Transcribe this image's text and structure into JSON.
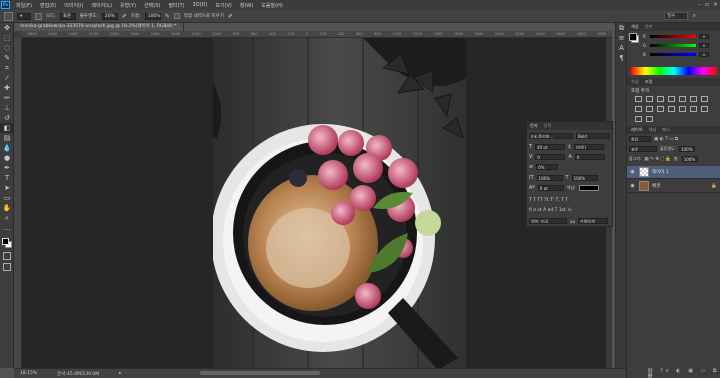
{
  "menubar": {
    "logo": "Ps",
    "items": [
      "파일(F)",
      "편집(E)",
      "이미지(I)",
      "레이어(L)",
      "유형(Y)",
      "선택(S)",
      "필터(T)",
      "3D(D)",
      "보기(V)",
      "창(W)",
      "도움말(H)"
    ]
  },
  "options": {
    "mode_label": "모드:",
    "mode_value": "표준",
    "opacity_label": "불투명도:",
    "opacity_value": "20%",
    "flow_label": "흐름:",
    "flow_value": "100%",
    "history_label": "작업 내역으로 지우기",
    "workspace_value": "필수"
  },
  "document": {
    "tab_title": "monika-grabkowska-323578-unsplash.jpg @ 18.2%(레이어 1, RGB/8) *",
    "ruler_ticks": [
      "2800",
      "2600",
      "2400",
      "2200",
      "2000",
      "1800",
      "1600",
      "1400",
      "1200",
      "1000",
      "800",
      "600",
      "400",
      "200",
      "0",
      "200",
      "400",
      "600",
      "800",
      "1000",
      "1200",
      "1400",
      "1600",
      "1800",
      "2000",
      "2200",
      "2400",
      "2600",
      "2800",
      "3000"
    ]
  },
  "status": {
    "zoom": "18.15%",
    "doc_info": "문서:45.4M/139.0M"
  },
  "character_panel": {
    "tabs": [
      "문자",
      "단락"
    ],
    "font_family": "Ink 플리퍼...",
    "font_style": "Bold",
    "font_size": "40 pt",
    "leading": "(자동)",
    "kerning": "0",
    "tracking": "0",
    "scale_pct": "0%",
    "vertical_scale": "100%",
    "horizontal_scale": "100%",
    "baseline": "0 pt",
    "color_label": "색상:",
    "language": "영어: 미국",
    "antialias": "선명하게"
  },
  "color_panel": {
    "tabs": [
      "색상",
      "견본"
    ],
    "r_label": "R",
    "g_label": "G",
    "b_label": "B",
    "r_value": "0",
    "g_value": "0",
    "b_value": "0"
  },
  "adjustments_panel": {
    "tabs": [
      "속성",
      "조정"
    ],
    "title": "조정 추가"
  },
  "layers_panel": {
    "tabs": [
      "레이어",
      "채널",
      "패스"
    ],
    "filter_label": "종류",
    "blend_mode": "표준",
    "opacity_label": "불투명도:",
    "opacity_value": "100%",
    "lock_label": "잠그기:",
    "fill_label": "칠:",
    "fill_value": "100%",
    "layers": [
      {
        "name": "레이어 1",
        "selected": true
      },
      {
        "name": "배경",
        "selected": false
      }
    ]
  },
  "colors": {
    "accent": "#31a8ff",
    "panel_bg": "#3d3d3d",
    "canvas_bg": "#262626",
    "selected_layer": "#4f5f77"
  }
}
